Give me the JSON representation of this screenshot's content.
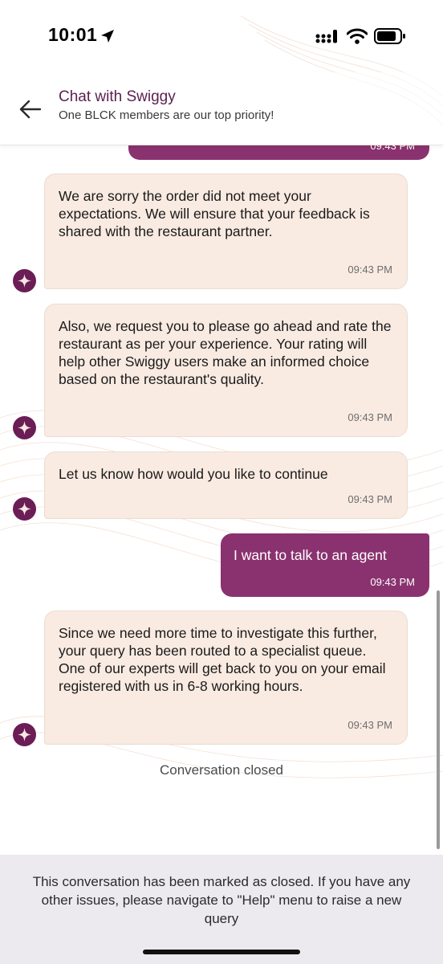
{
  "status_bar": {
    "time": "10:01"
  },
  "header": {
    "title": "Chat with Swiggy",
    "subtitle": "One BLCK members are our top priority!"
  },
  "messages": [
    {
      "sender": "bot",
      "text": "We are sorry the order did not meet your expectations. We will ensure that your feedback is shared with the restaurant partner.",
      "time": "09:43 PM"
    },
    {
      "sender": "bot",
      "text": "Also, we request you to please go ahead and rate the restaurant as per your experience. Your rating will help other Swiggy users make an informed choice based on the restaurant's quality.",
      "time": "09:43 PM"
    },
    {
      "sender": "bot",
      "text": "Let us know how would you like to continue",
      "time": "09:43 PM"
    },
    {
      "sender": "user",
      "text": "I want to talk to an agent",
      "time": "09:43 PM"
    },
    {
      "sender": "bot",
      "text": "Since we need more time to investigate this further, your query has been routed to a specialist queue. One of our experts will get back to you on your email registered with us in 6-8 working hours.",
      "time": "09:43 PM"
    }
  ],
  "previous_message_time": "09:43 PM",
  "conversation_status": "Conversation closed",
  "footer": {
    "notice": "This conversation has been marked as closed. If you have any other issues, please navigate to \"Help\" menu to raise a new query"
  },
  "icons": {
    "back": "arrow-left-icon",
    "avatar": "sparkle-icon",
    "location": "location-arrow-icon",
    "signal": "cellular-signal-icon",
    "wifi": "wifi-icon",
    "battery": "battery-icon"
  },
  "colors": {
    "brand_purple": "#8a326f",
    "header_title": "#5a1f4f",
    "bot_bubble": "#f9ebe2",
    "avatar_bg": "#6b1d55",
    "footer_bg": "#eceaef"
  }
}
